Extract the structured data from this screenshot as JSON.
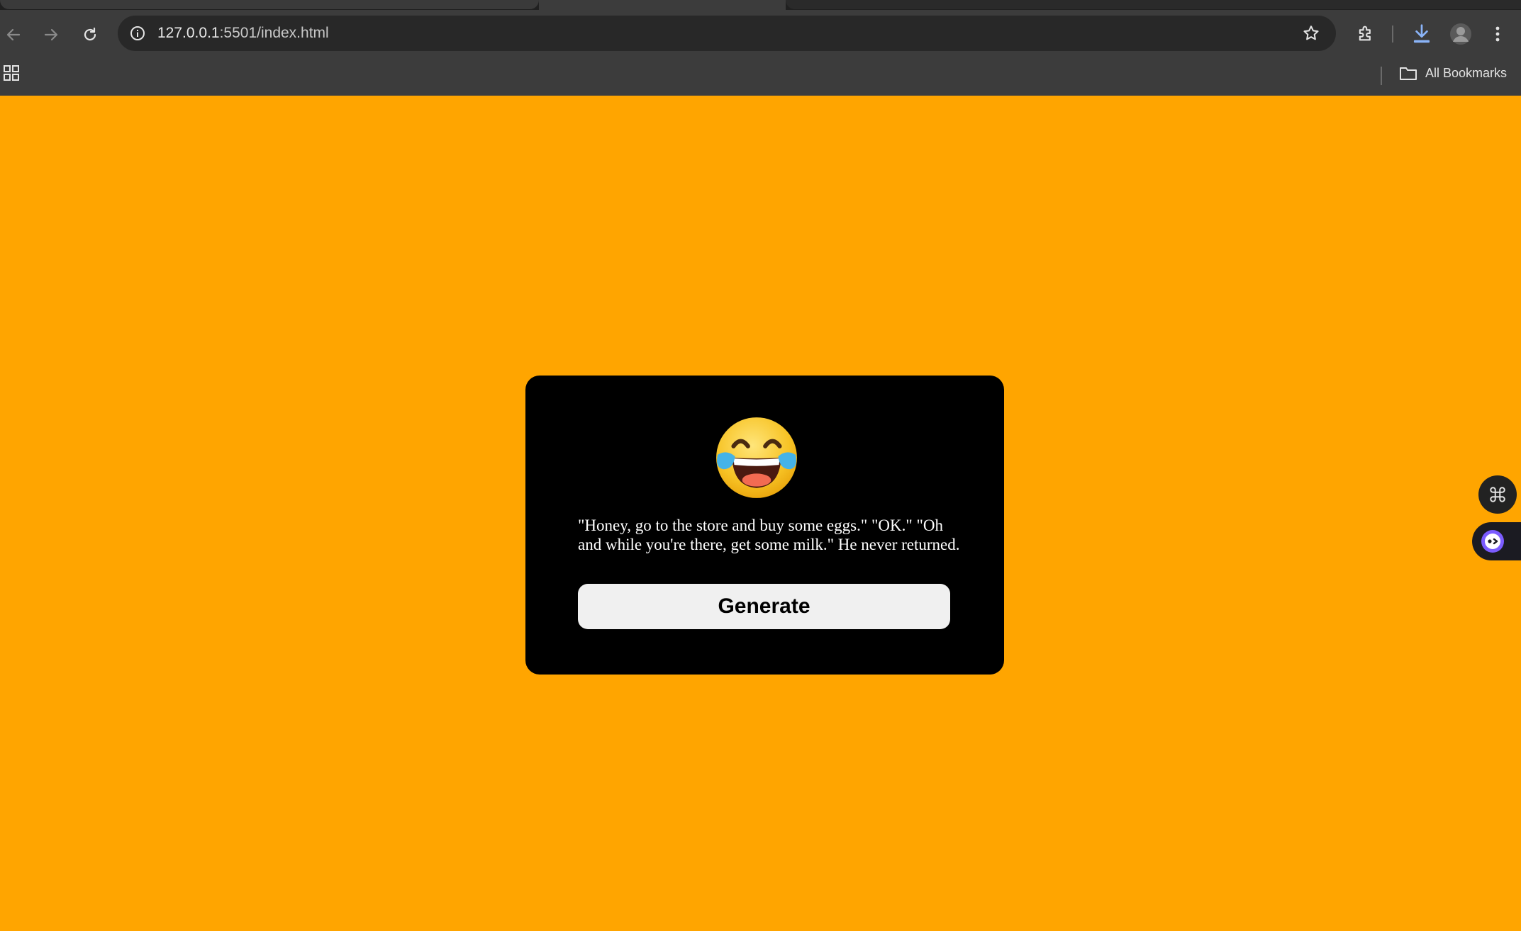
{
  "browser": {
    "url_host": "127.0.0.1",
    "url_rest": ":5501/index.html",
    "bookmarks_label": "All Bookmarks"
  },
  "icons": {
    "back": "back-arrow-icon",
    "forward": "forward-arrow-icon",
    "reload": "reload-icon",
    "site_info": "info-icon",
    "bookmark_star": "star-icon",
    "extensions": "puzzle-icon",
    "download": "download-icon",
    "profile": "avatar",
    "menu": "kebab-menu-icon",
    "apps": "apps-grid-icon",
    "folder": "folder-icon",
    "emoji": "tears-of-joy-emoji"
  },
  "colors": {
    "page_background": "#FFA500",
    "card_background": "#000000",
    "button_background": "#f0f0f0"
  },
  "card": {
    "joke_text": "\"Honey, go to the store and buy some eggs.\" \"OK.\" \"Oh and while you're there, get some milk.\" He never returned.",
    "button_label": "Generate"
  }
}
